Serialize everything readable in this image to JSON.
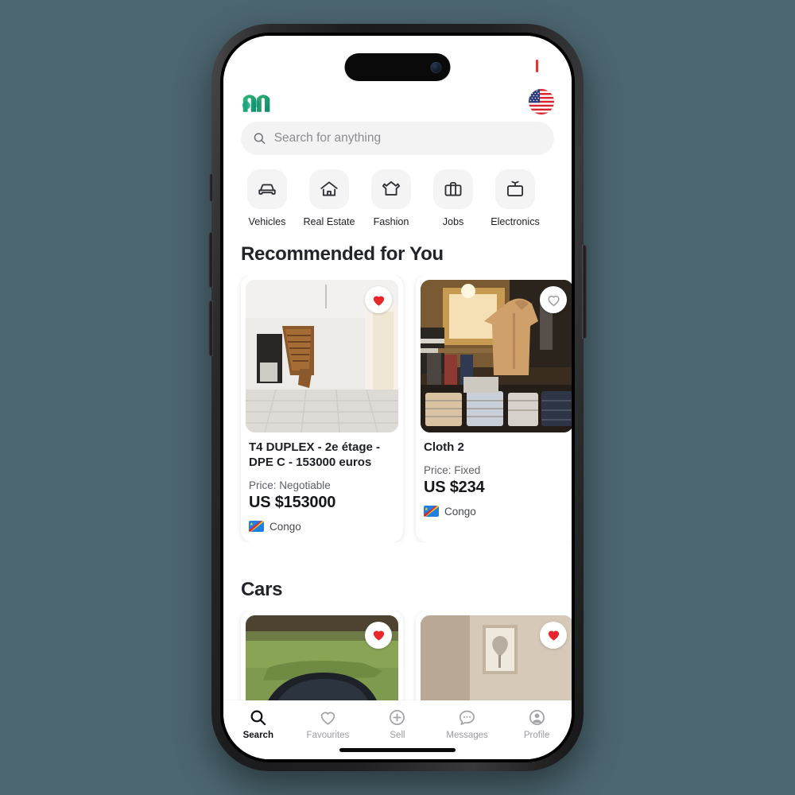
{
  "device": {
    "status_indicator_color": "#e8342c",
    "frame_color": "#202022",
    "background_color": "#4c6670"
  },
  "header": {
    "logo_name": "m-logo",
    "logo_colors": [
      "#2aa866",
      "#13a97f",
      "#0f8f72"
    ],
    "language_flag": "us-flag",
    "language_flag_label": "United States"
  },
  "search": {
    "placeholder": "Search for anything",
    "value": "",
    "icon": "search-icon"
  },
  "categories": [
    {
      "label": "Vehicles",
      "icon": "car-icon"
    },
    {
      "label": "Real Estate",
      "icon": "home-icon"
    },
    {
      "label": "Fashion",
      "icon": "tshirt-icon"
    },
    {
      "label": "Jobs",
      "icon": "briefcase-icon"
    },
    {
      "label": "Electronics",
      "icon": "tv-icon"
    }
  ],
  "sections": [
    {
      "title": "Recommended for You",
      "items": [
        {
          "title": "T4 DUPLEX - 2e étage - DPE C - 153000 euros",
          "price_label": "Price: Negotiable",
          "price": "US $153000",
          "location": "Congo",
          "location_flag": "cd-flag",
          "favourited": true,
          "image": "empty-room-with-wooden-staircase"
        },
        {
          "title": "Cloth 2",
          "price_label": "Price: Fixed",
          "price": "US $234",
          "location": "Congo",
          "location_flag": "cd-flag",
          "favourited": false,
          "image": "clothing-store-mannequin-tan-shirt"
        }
      ]
    },
    {
      "title": "Cars",
      "items": [
        {
          "title": "",
          "price_label": "",
          "price": "",
          "location": "",
          "location_flag": "cd-flag",
          "favourited": true,
          "image": "blue-car-on-grass"
        },
        {
          "title": "",
          "price_label": "",
          "price": "",
          "location": "",
          "location_flag": "cd-flag",
          "favourited": true,
          "image": "beige-interior-framed-art"
        }
      ]
    }
  ],
  "tabbar": {
    "active": "Search",
    "items": [
      {
        "label": "Search",
        "icon": "magnifier-icon"
      },
      {
        "label": "Favourites",
        "icon": "heart-outline-icon"
      },
      {
        "label": "Sell",
        "icon": "plus-circle-icon"
      },
      {
        "label": "Messages",
        "icon": "chat-bubble-icon"
      },
      {
        "label": "Profile",
        "icon": "person-circle-icon"
      }
    ]
  }
}
